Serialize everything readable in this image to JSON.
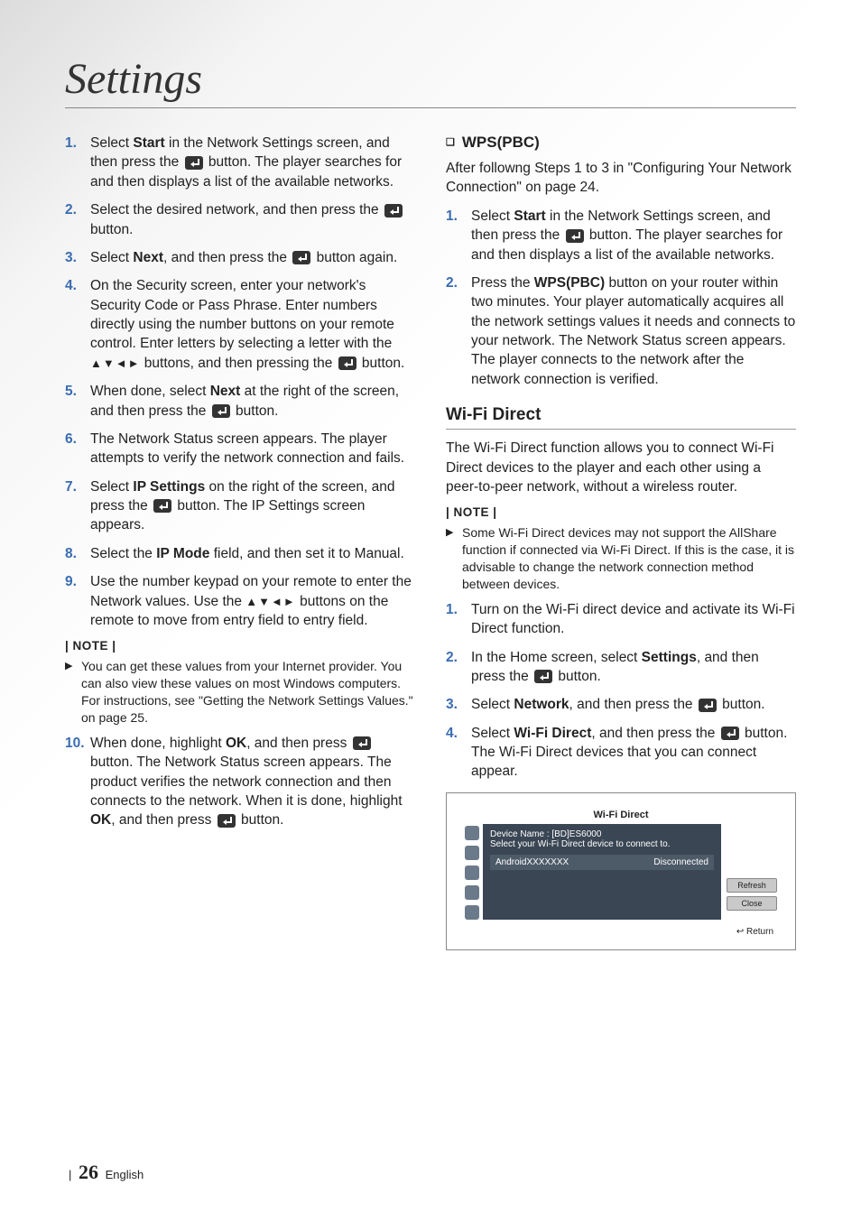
{
  "title": "Settings",
  "left": {
    "steps": [
      {
        "n": "1.",
        "pre": "Select ",
        "b1": "Start",
        "mid1": " in the Network Settings screen, and then press the ",
        "icon": true,
        "mid2": " button. The player searches for and then displays a list of the available networks."
      },
      {
        "n": "2.",
        "pre": "Select the desired network, and then press the ",
        "icon": true,
        "mid2": " button."
      },
      {
        "n": "3.",
        "pre": "Select ",
        "b1": "Next",
        "mid1": ", and then press the ",
        "icon": true,
        "mid2": " button again."
      },
      {
        "n": "4.",
        "pre": "On the Security screen, enter your network's Security Code or Pass Phrase. Enter numbers directly using the number buttons on your remote control. Enter letters by selecting a letter with the ",
        "arrows": "▲▼◄►",
        "mid1": " buttons, and then pressing the ",
        "icon": true,
        "mid2": " button."
      },
      {
        "n": "5.",
        "pre": "When done, select ",
        "b1": "Next",
        "mid1": " at the right of the screen, and then press the ",
        "icon": true,
        "mid2": " button."
      },
      {
        "n": "6.",
        "pre": "The Network Status screen appears. The player attempts to verify the network connection and fails."
      },
      {
        "n": "7.",
        "pre": "Select ",
        "b1": "IP Settings",
        "mid1": " on the right of the screen, and press the ",
        "icon": true,
        "mid2": " button. The IP Settings screen appears."
      },
      {
        "n": "8.",
        "pre": "Select the ",
        "b1": "IP Mode",
        "mid1": " field, and then set it to Manual."
      },
      {
        "n": "9.",
        "pre": "Use the number keypad on your remote to enter the Network values. Use the ",
        "arrows": "▲▼◄►",
        "mid1": " buttons on the remote to move from entry field to entry field."
      }
    ],
    "note_hdr": "| NOTE |",
    "note": "You can get these values from your Internet provider. You can also view these values on most Windows computers. For instructions, see \"Getting the Network Settings Values.\" on page 25.",
    "step10": {
      "n": "10.",
      "pre": "When done, highlight ",
      "b1": "OK",
      "mid1": ", and then press ",
      "icon": true,
      "mid2": " button. The Network Status screen appears. The product verifies the network connection and then connects to the network. When it is done, highlight ",
      "b2": "OK",
      "mid3": ", and then press ",
      "icon2": true,
      "mid4": " button."
    }
  },
  "right": {
    "wps_hdr": "WPS(PBC)",
    "wps_intro": "After followng Steps 1 to 3 in \"Configuring Your Network Connection\" on page 24.",
    "wps_steps": [
      {
        "n": "1.",
        "pre": "Select ",
        "b1": "Start",
        "mid1": " in the Network Settings screen, and then press the ",
        "icon": true,
        "mid2": " button. The player searches for and then displays a list of the available networks."
      },
      {
        "n": "2.",
        "pre": "Press the ",
        "b1": "WPS(PBC)",
        "mid1": " button on your router within two minutes. Your player automatically acquires all the network settings values it needs and connects to your network. The Network Status screen appears. The player connects to the network after the network connection is verified."
      }
    ],
    "wifi_hdr": "Wi-Fi Direct",
    "wifi_intro": "The Wi-Fi Direct function allows you to connect Wi-Fi Direct devices to the player and each other using a peer-to-peer network, without a wireless router.",
    "note_hdr": "| NOTE |",
    "wifi_note": "Some Wi-Fi Direct devices may not support the AllShare function if connected via Wi-Fi Direct. If this is the case, it is advisable to change the network connection method between devices.",
    "wifi_steps": [
      {
        "n": "1.",
        "pre": "Turn on the Wi-Fi direct device and activate its Wi-Fi Direct function."
      },
      {
        "n": "2.",
        "pre": "In the Home screen, select ",
        "b1": "Settings",
        "mid1": ", and then press the ",
        "icon": true,
        "mid2": " button."
      },
      {
        "n": "3.",
        "pre": "Select ",
        "b1": "Network",
        "mid1": ", and then press the ",
        "icon": true,
        "mid2": " button."
      },
      {
        "n": "4.",
        "pre": "Select ",
        "b1": "Wi-Fi Direct",
        "mid1": ", and then press the ",
        "icon": true,
        "mid2": " button.\nThe Wi-Fi Direct devices that you can connect appear."
      }
    ],
    "ss": {
      "title": "Wi-Fi Direct",
      "device": "Device Name : [BD]ES6000",
      "select": "Select your Wi-Fi Direct device to connect to.",
      "row_name": "AndroidXXXXXXX",
      "row_status": "Disconnected",
      "refresh": "Refresh",
      "close": "Close",
      "return": "Return"
    }
  },
  "footer": {
    "page": "26",
    "lang": "English",
    "bar": "|"
  }
}
